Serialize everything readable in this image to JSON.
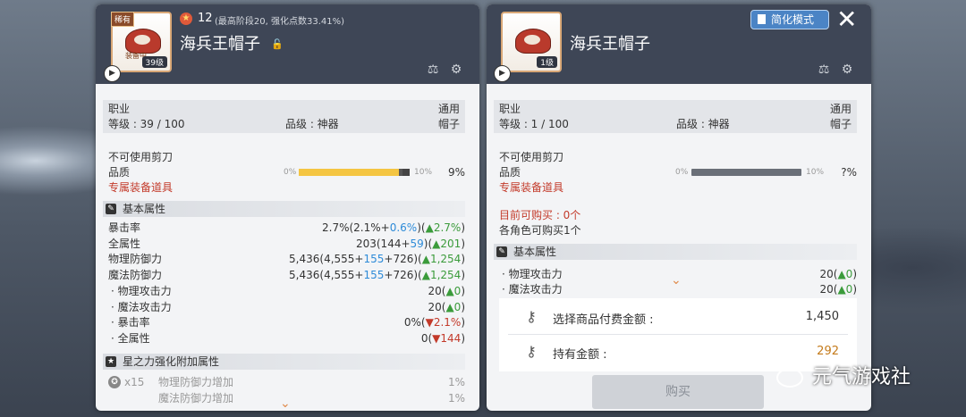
{
  "left": {
    "legend_tag": "稀有",
    "equipped_badge": "装备中",
    "level_badge": "39级",
    "star_count": "12",
    "star_note": "(最高阶段20, 强化点数33.41%)",
    "item_name": "海兵王帽子",
    "job_label": "职业",
    "job_value": "通用",
    "level_text": "等级 : 39 / 100",
    "grade_text": "品级 : 神器",
    "type_value": "帽子",
    "no_scissors": "不可使用剪刀",
    "quality_label": "品质",
    "quality_min": "0%",
    "quality_max": "10%",
    "quality_value": "9%",
    "quality_fill": 0.9,
    "exclusive": "专属装备道具",
    "basic_section": "基本属性",
    "stats": [
      {
        "name": "暴击率",
        "pre": "2.7%(2.1%+",
        "add": "0.6%",
        "mid": ")(",
        "delta": "▲2.7%",
        "post": ")",
        "delta_color": "green"
      },
      {
        "name": "全属性",
        "pre": "203(144+",
        "add": "59",
        "mid": ")(",
        "delta": "▲201",
        "post": ")",
        "delta_color": "green"
      },
      {
        "name": "物理防御力",
        "pre": "5,436(4,555+",
        "add": "155",
        "mid": "+726)(",
        "delta": "▲1,254",
        "post": ")",
        "delta_color": "green"
      },
      {
        "name": "魔法防御力",
        "pre": "5,436(4,555+",
        "add": "155",
        "mid": "+726)(",
        "delta": "▲1,254",
        "post": ")",
        "delta_color": "green"
      },
      {
        "name": "· 物理攻击力",
        "pre": "20(",
        "add": "",
        "mid": "",
        "delta": "▲0",
        "post": ")",
        "delta_color": "green"
      },
      {
        "name": "· 魔法攻击力",
        "pre": "20(",
        "add": "",
        "mid": "",
        "delta": "▲0",
        "post": ")",
        "delta_color": "green"
      },
      {
        "name": "· 暴击率",
        "pre": "0%(",
        "add": "",
        "mid": "",
        "delta": "▼2.1%",
        "post": ")",
        "delta_color": "red"
      },
      {
        "name": "· 全属性",
        "pre": "0(",
        "add": "",
        "mid": "",
        "delta": "▼144",
        "post": ")",
        "delta_color": "red"
      }
    ],
    "star_section": "星之力强化附加属性",
    "star_mult": "x15",
    "star_stats": [
      {
        "name": "物理防御力增加",
        "value": "1%"
      },
      {
        "name": "魔法防御力增加",
        "value": "1%"
      }
    ]
  },
  "right": {
    "simple_mode": "简化模式",
    "level_badge": "1级",
    "item_name": "海兵王帽子",
    "job_label": "职业",
    "job_value": "通用",
    "level_text": "等级 : 1 / 100",
    "grade_text": "品级 : 神器",
    "type_value": "帽子",
    "no_scissors": "不可使用剪刀",
    "quality_label": "品质",
    "quality_min": "0%",
    "quality_max": "10%",
    "quality_value": "?%",
    "exclusive": "专属装备道具",
    "buy_limit": "目前可购买 : 0个",
    "per_char": "各角色可购买1个",
    "basic_section": "基本属性",
    "stats": [
      {
        "name": "· 物理攻击力",
        "pre": "20(",
        "delta": "▲0",
        "post": ")"
      },
      {
        "name": "· 魔法攻击力",
        "pre": "20(",
        "delta": "▲0",
        "post": ")"
      }
    ],
    "pay_label": "选择商品付费金额 :",
    "pay_value": "1,450",
    "own_label": "持有金额 :",
    "own_value": "292",
    "buy_button": "购买"
  },
  "watermark": "元气游戏社"
}
